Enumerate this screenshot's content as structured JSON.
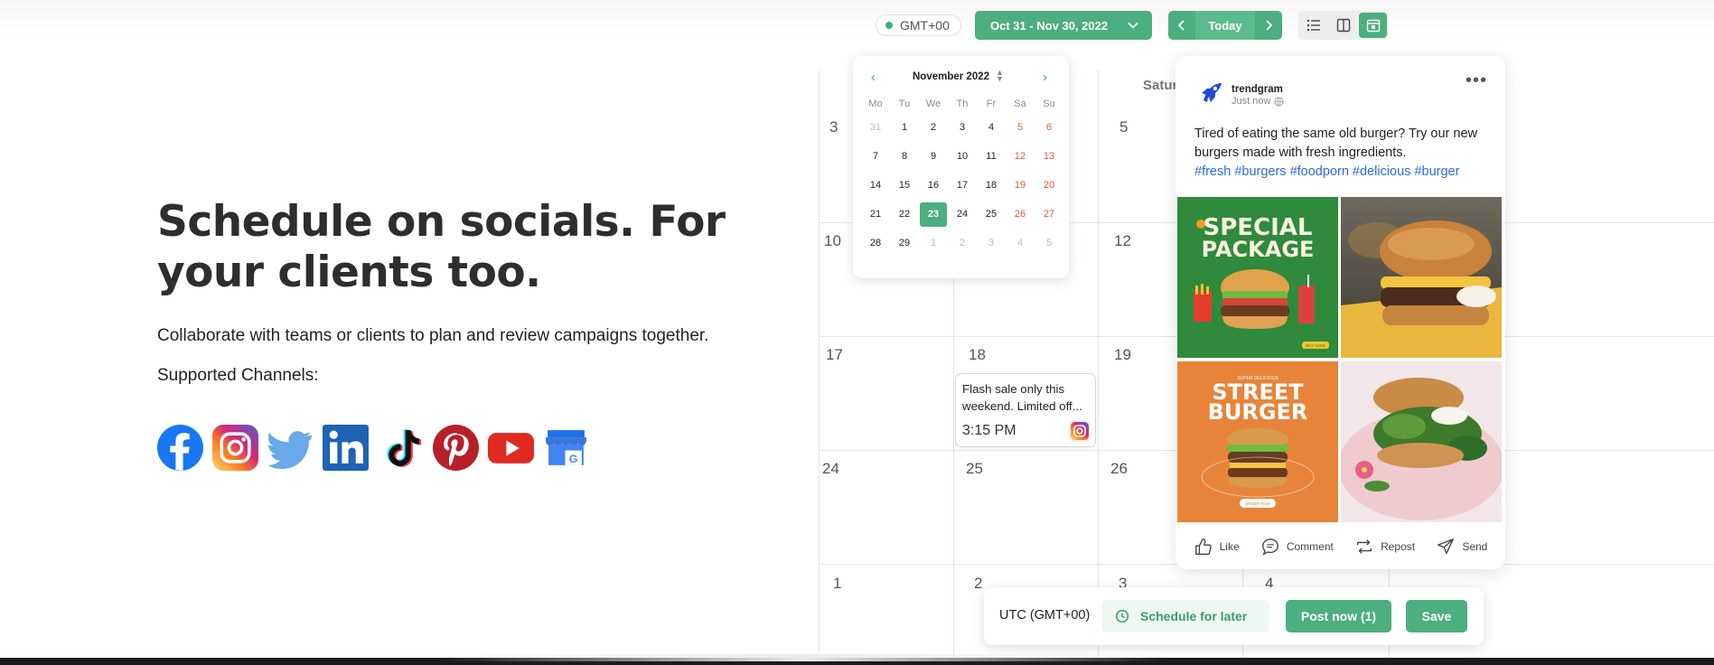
{
  "hero": {
    "title": "Schedule on socials. For your clients too.",
    "subtitle": "Collaborate with teams or clients to plan and review campaigns together.",
    "channels_label": "Supported Channels:",
    "channels": [
      "facebook-icon",
      "instagram-icon",
      "twitter-icon",
      "linkedin-icon",
      "tiktok-icon",
      "pinterest-icon",
      "youtube-icon",
      "google-business-icon"
    ]
  },
  "toolbar": {
    "timezone": "GMT+00",
    "date_range": "Oct 31 - Nov 30, 2022",
    "today_label": "Today",
    "views": [
      "list-view-icon",
      "columns-view-icon",
      "calendar-view-icon"
    ],
    "active_view": "calendar-view-icon"
  },
  "calendar": {
    "column_header": "Satur",
    "day_numbers": {
      "r1": [
        "3",
        "5"
      ],
      "r2": [
        "10",
        "12"
      ],
      "r3": [
        "17",
        "18",
        "19"
      ],
      "r4": [
        "24",
        "25",
        "26"
      ],
      "r5": [
        "1",
        "2",
        "3",
        "4"
      ]
    }
  },
  "datepicker": {
    "month_label": "November 2022",
    "weekdays": [
      "Mo",
      "Tu",
      "We",
      "Th",
      "Fr",
      "Sa",
      "Su"
    ],
    "weeks": [
      [
        "31",
        "1",
        "2",
        "3",
        "4",
        "5",
        "6"
      ],
      [
        "7",
        "8",
        "9",
        "10",
        "11",
        "12",
        "13"
      ],
      [
        "14",
        "15",
        "16",
        "17",
        "18",
        "19",
        "20"
      ],
      [
        "21",
        "22",
        "23",
        "24",
        "25",
        "26",
        "27"
      ],
      [
        "28",
        "29",
        "1",
        "2",
        "3",
        "4",
        "5"
      ]
    ],
    "selected": "23"
  },
  "event": {
    "text": "Flash sale only this weekend. Limited off...",
    "time": "3:15 PM",
    "network_icon": "instagram-icon"
  },
  "post": {
    "account": "trendgram",
    "posted": "Just now",
    "caption": "Tired of eating the same old burger? Try our new burgers made with fresh ingredients.",
    "hashtags": "#fresh #burgers #foodporn #delicious #burger",
    "images": {
      "img1_line1": "SPECIAL",
      "img1_line2": "PACKAGE",
      "img1_button": "BUY NOW",
      "img3_kicker": "SUPER DELICIOUS",
      "img3_line1": "STREET",
      "img3_line2": "BURGER",
      "img3_button": "ORDER NOW"
    },
    "actions": [
      "Like",
      "Comment",
      "Repost",
      "Send"
    ]
  },
  "actionbar": {
    "timezone": "UTC (GMT+00)",
    "schedule_label": "Schedule for later",
    "post_now_label": "Post now (1)",
    "save_label": "Save"
  },
  "colors": {
    "accent": "#4caf7d",
    "weekend": "#e05a3a",
    "hashtag": "#2c6bd9"
  }
}
